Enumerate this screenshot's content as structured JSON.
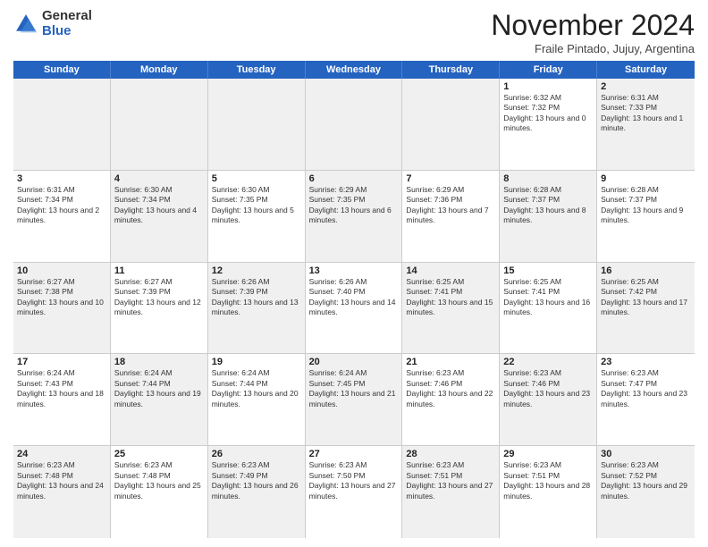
{
  "logo": {
    "general": "General",
    "blue": "Blue"
  },
  "title": "November 2024",
  "subtitle": "Fraile Pintado, Jujuy, Argentina",
  "header_days": [
    "Sunday",
    "Monday",
    "Tuesday",
    "Wednesday",
    "Thursday",
    "Friday",
    "Saturday"
  ],
  "weeks": [
    [
      {
        "day": "",
        "info": "",
        "shaded": true
      },
      {
        "day": "",
        "info": "",
        "shaded": true
      },
      {
        "day": "",
        "info": "",
        "shaded": true
      },
      {
        "day": "",
        "info": "",
        "shaded": true
      },
      {
        "day": "",
        "info": "",
        "shaded": true
      },
      {
        "day": "1",
        "info": "Sunrise: 6:32 AM\nSunset: 7:32 PM\nDaylight: 13 hours and 0 minutes.",
        "shaded": false
      },
      {
        "day": "2",
        "info": "Sunrise: 6:31 AM\nSunset: 7:33 PM\nDaylight: 13 hours and 1 minute.",
        "shaded": true
      }
    ],
    [
      {
        "day": "3",
        "info": "Sunrise: 6:31 AM\nSunset: 7:34 PM\nDaylight: 13 hours and 2 minutes.",
        "shaded": false
      },
      {
        "day": "4",
        "info": "Sunrise: 6:30 AM\nSunset: 7:34 PM\nDaylight: 13 hours and 4 minutes.",
        "shaded": true
      },
      {
        "day": "5",
        "info": "Sunrise: 6:30 AM\nSunset: 7:35 PM\nDaylight: 13 hours and 5 minutes.",
        "shaded": false
      },
      {
        "day": "6",
        "info": "Sunrise: 6:29 AM\nSunset: 7:35 PM\nDaylight: 13 hours and 6 minutes.",
        "shaded": true
      },
      {
        "day": "7",
        "info": "Sunrise: 6:29 AM\nSunset: 7:36 PM\nDaylight: 13 hours and 7 minutes.",
        "shaded": false
      },
      {
        "day": "8",
        "info": "Sunrise: 6:28 AM\nSunset: 7:37 PM\nDaylight: 13 hours and 8 minutes.",
        "shaded": true
      },
      {
        "day": "9",
        "info": "Sunrise: 6:28 AM\nSunset: 7:37 PM\nDaylight: 13 hours and 9 minutes.",
        "shaded": false
      }
    ],
    [
      {
        "day": "10",
        "info": "Sunrise: 6:27 AM\nSunset: 7:38 PM\nDaylight: 13 hours and 10 minutes.",
        "shaded": true
      },
      {
        "day": "11",
        "info": "Sunrise: 6:27 AM\nSunset: 7:39 PM\nDaylight: 13 hours and 12 minutes.",
        "shaded": false
      },
      {
        "day": "12",
        "info": "Sunrise: 6:26 AM\nSunset: 7:39 PM\nDaylight: 13 hours and 13 minutes.",
        "shaded": true
      },
      {
        "day": "13",
        "info": "Sunrise: 6:26 AM\nSunset: 7:40 PM\nDaylight: 13 hours and 14 minutes.",
        "shaded": false
      },
      {
        "day": "14",
        "info": "Sunrise: 6:25 AM\nSunset: 7:41 PM\nDaylight: 13 hours and 15 minutes.",
        "shaded": true
      },
      {
        "day": "15",
        "info": "Sunrise: 6:25 AM\nSunset: 7:41 PM\nDaylight: 13 hours and 16 minutes.",
        "shaded": false
      },
      {
        "day": "16",
        "info": "Sunrise: 6:25 AM\nSunset: 7:42 PM\nDaylight: 13 hours and 17 minutes.",
        "shaded": true
      }
    ],
    [
      {
        "day": "17",
        "info": "Sunrise: 6:24 AM\nSunset: 7:43 PM\nDaylight: 13 hours and 18 minutes.",
        "shaded": false
      },
      {
        "day": "18",
        "info": "Sunrise: 6:24 AM\nSunset: 7:44 PM\nDaylight: 13 hours and 19 minutes.",
        "shaded": true
      },
      {
        "day": "19",
        "info": "Sunrise: 6:24 AM\nSunset: 7:44 PM\nDaylight: 13 hours and 20 minutes.",
        "shaded": false
      },
      {
        "day": "20",
        "info": "Sunrise: 6:24 AM\nSunset: 7:45 PM\nDaylight: 13 hours and 21 minutes.",
        "shaded": true
      },
      {
        "day": "21",
        "info": "Sunrise: 6:23 AM\nSunset: 7:46 PM\nDaylight: 13 hours and 22 minutes.",
        "shaded": false
      },
      {
        "day": "22",
        "info": "Sunrise: 6:23 AM\nSunset: 7:46 PM\nDaylight: 13 hours and 23 minutes.",
        "shaded": true
      },
      {
        "day": "23",
        "info": "Sunrise: 6:23 AM\nSunset: 7:47 PM\nDaylight: 13 hours and 23 minutes.",
        "shaded": false
      }
    ],
    [
      {
        "day": "24",
        "info": "Sunrise: 6:23 AM\nSunset: 7:48 PM\nDaylight: 13 hours and 24 minutes.",
        "shaded": true
      },
      {
        "day": "25",
        "info": "Sunrise: 6:23 AM\nSunset: 7:48 PM\nDaylight: 13 hours and 25 minutes.",
        "shaded": false
      },
      {
        "day": "26",
        "info": "Sunrise: 6:23 AM\nSunset: 7:49 PM\nDaylight: 13 hours and 26 minutes.",
        "shaded": true
      },
      {
        "day": "27",
        "info": "Sunrise: 6:23 AM\nSunset: 7:50 PM\nDaylight: 13 hours and 27 minutes.",
        "shaded": false
      },
      {
        "day": "28",
        "info": "Sunrise: 6:23 AM\nSunset: 7:51 PM\nDaylight: 13 hours and 27 minutes.",
        "shaded": true
      },
      {
        "day": "29",
        "info": "Sunrise: 6:23 AM\nSunset: 7:51 PM\nDaylight: 13 hours and 28 minutes.",
        "shaded": false
      },
      {
        "day": "30",
        "info": "Sunrise: 6:23 AM\nSunset: 7:52 PM\nDaylight: 13 hours and 29 minutes.",
        "shaded": true
      }
    ]
  ]
}
